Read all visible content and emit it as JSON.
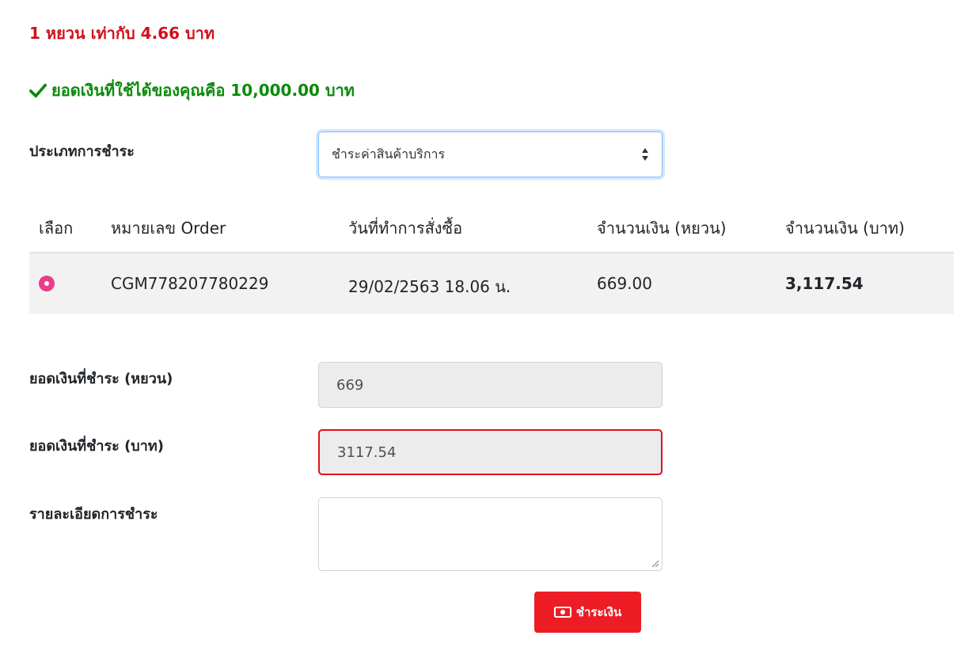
{
  "rate_text": "1 หยวน เท่ากับ 4.66 บาท",
  "balance_text": "ยอดเงินที่ใช้ได้ของคุณคือ 10,000.00 บาท",
  "payment_type": {
    "label": "ประเภทการชำระ",
    "selected": "ชำระค่าสินค้าบริการ"
  },
  "table": {
    "headers": [
      "เลือก",
      "หมายเลข Order",
      "วันที่ทำการสั่งซื้อ",
      "จำนวนเงิน (หยวน)",
      "จำนวนเงิน (บาท)"
    ],
    "rows": [
      {
        "selected": true,
        "order_no": "CGM778207780229",
        "order_date": "29/02/2563 18.06 น.",
        "amount_yuan": "669.00",
        "amount_baht": "3,117.54"
      }
    ]
  },
  "form": {
    "yuan_label": "ยอดเงินที่ชำระ (หยวน)",
    "yuan_value": "669",
    "baht_label": "ยอดเงินที่ชำระ (บาท)",
    "baht_value": "3117.54",
    "details_label": "รายละเอียดการชำระ",
    "details_value": ""
  },
  "pay_button": {
    "label": "ชำระเงิน",
    "icon": "money-icon"
  },
  "colors": {
    "rate_text": "#d0101a",
    "balance_text": "#0a8a0a",
    "radio_selected": "#e83e8c",
    "button_bg": "#ee1c25",
    "error_border": "#e0101a"
  }
}
